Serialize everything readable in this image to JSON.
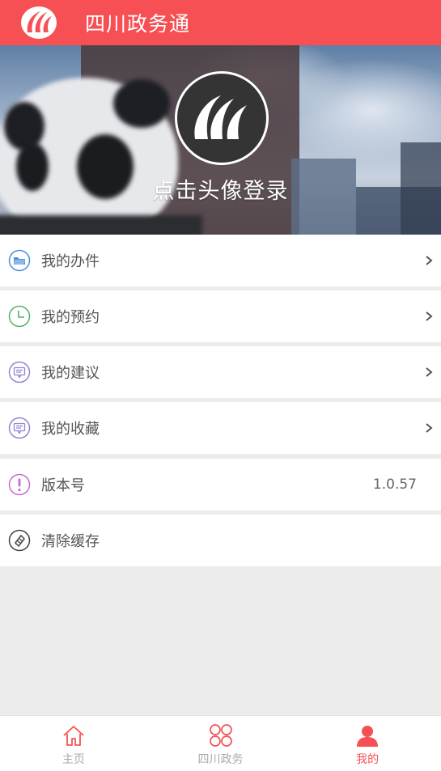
{
  "header": {
    "title": "四川政务通",
    "logo_icon": "app-logo-icon",
    "bg_color": "#f65054"
  },
  "hero": {
    "login_text": "点击头像登录",
    "avatar_icon": "app-logo-icon"
  },
  "menu": [
    {
      "id": "my-affairs",
      "label": "我的办件",
      "icon": "folder-icon",
      "icon_color": "#4d8fdc",
      "arrow": true
    },
    {
      "id": "my-appointments",
      "label": "我的预约",
      "icon": "clock-icon",
      "icon_color": "#52b36a",
      "arrow": true
    },
    {
      "id": "my-suggestions",
      "label": "我的建议",
      "icon": "message-icon",
      "icon_color": "#8f86d6",
      "arrow": true
    },
    {
      "id": "my-favorites",
      "label": "我的收藏",
      "icon": "message-icon",
      "icon_color": "#8f86d6",
      "arrow": true
    },
    {
      "id": "version",
      "label": "版本号",
      "icon": "exclamation-icon",
      "icon_color": "#c96bd0",
      "value": "1.0.57"
    },
    {
      "id": "clear-cache",
      "label": "清除缓存",
      "icon": "eraser-icon",
      "icon_color": "#444444"
    }
  ],
  "tabbar": {
    "active_color": "#f65054",
    "items": [
      {
        "label": "主页",
        "icon": "home-icon",
        "active": false
      },
      {
        "label": "四川政务",
        "icon": "grid-icon",
        "active": false
      },
      {
        "label": "我的",
        "icon": "user-icon",
        "active": true
      }
    ]
  }
}
